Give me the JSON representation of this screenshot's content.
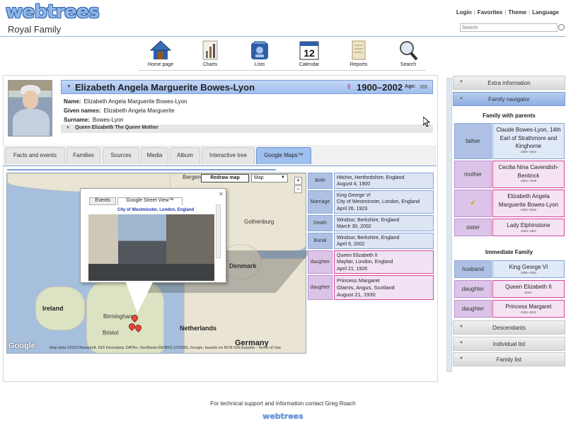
{
  "header": {
    "logo": "webtrees",
    "site_title": "Royal Family",
    "links": [
      "Login",
      "Favorites",
      "Theme",
      "Language"
    ],
    "search_placeholder": "Search"
  },
  "menu": [
    {
      "label": "Home page",
      "icon": "home-icon"
    },
    {
      "label": "Charts",
      "icon": "charts-icon"
    },
    {
      "label": "Lists",
      "icon": "lists-icon"
    },
    {
      "label": "Calendar",
      "icon": "calendar-icon",
      "day": "12"
    },
    {
      "label": "Reports",
      "icon": "reports-icon"
    },
    {
      "label": "Search",
      "icon": "search-icon"
    }
  ],
  "individual": {
    "full_name": "Elizabeth Angela Marguerite Bowes-Lyon",
    "life_years": "1900–2002",
    "age_label": "Age:",
    "age": "101",
    "sex_icon": "female-icon",
    "facts": [
      {
        "label": "Name:",
        "value": "Elizabeth Angela Marguerite Bowes-Lyon"
      },
      {
        "label": "Given names:",
        "value": "Elizabeth Angela Marguerite"
      },
      {
        "label": "Surname:",
        "value": "Bowes-Lyon"
      }
    ],
    "nickname": "Queen Elizabeth The Queen Mother"
  },
  "tabs": [
    "Facts and events",
    "Families",
    "Sources",
    "Media",
    "Album",
    "Interactive tree",
    "Google Maps™"
  ],
  "active_tab": "Google Maps™",
  "map": {
    "redraw_label": "Redraw map",
    "maptype": "Map",
    "zoom_in": "+",
    "zoom_out": "−",
    "popup_tabs": [
      "Events",
      "Google Street View™"
    ],
    "popup_place": "City of Westminster, London, England",
    "labels": {
      "bergen": "Bergen",
      "gothenburg": "Gothenburg",
      "denmark": "Denmark",
      "ireland": "Ireland",
      "birmingham": "Birmingham",
      "bristol": "Bristol",
      "netherlands": "Netherlands",
      "germany": "Germany"
    },
    "google_logo": "Google",
    "credit": "Map data ©2013 Basarsoft, GIS Innovatsia, DATA+, GeoBasis-DE/BKG (©2009), Google, basado en BCN IGN España - Terms of Use"
  },
  "events": [
    {
      "type": "Birth",
      "lines": [
        "Hitchin, Hertfordshire, England",
        "August 4, 1900"
      ],
      "style": "blue"
    },
    {
      "type": "Marriage",
      "lines": [
        "King George VI",
        "City of Westminster, London, England",
        "April 26, 1923"
      ],
      "style": "blue"
    },
    {
      "type": "Death",
      "lines": [
        "Windsor, Berkshire, England",
        "March 30, 2002"
      ],
      "style": "blue"
    },
    {
      "type": "Burial",
      "lines": [
        "Windsor, Berkshire, England",
        "April 9, 2002"
      ],
      "style": "blue"
    },
    {
      "type": "daughter",
      "lines": [
        "Queen Elizabeth II",
        "Mayfair, London, England",
        "April 21, 1926"
      ],
      "style": "pink"
    },
    {
      "type": "daughter",
      "lines": [
        "Princess Margaret",
        "Glamis, Angus, Scotland",
        "August 21, 1930"
      ],
      "style": "pink"
    }
  ],
  "sidebar": {
    "extra_information": "Extra information",
    "family_navigator": "Family navigator",
    "family_with_parents": "Family with parents",
    "parents_family": [
      {
        "role": "father",
        "name": "Claude Bowes-Lyon, 14th Earl of Strathmore and Kinghorne",
        "years": "1855–1944",
        "style": "blue"
      },
      {
        "role": "mother",
        "name": "Cecilia Nina Cavendish-Bentinck",
        "years": "1862–1938",
        "style": "pink"
      },
      {
        "role": "✔",
        "name": "Elizabeth Angela Marguerite Bowes-Lyon",
        "years": "1900–2002",
        "style": "pink"
      },
      {
        "role": "sister",
        "name": "Lady Elphinstone",
        "years": "1883–1961",
        "style": "pink"
      }
    ],
    "immediate_family": "Immediate Family",
    "own_family": [
      {
        "role": "husband",
        "name": "King George VI",
        "years": "1895–1952",
        "style": "blue"
      },
      {
        "role": "daughter",
        "name": "Queen Elizabeth II",
        "years": "1926–",
        "style": "pink"
      },
      {
        "role": "daughter",
        "name": "Princess Margaret",
        "years": "1930–2002",
        "style": "pink"
      }
    ],
    "descendants": "Descendants",
    "individual_list": "Individual list",
    "family_list": "Family list"
  },
  "footer": {
    "text": "For technical support and information contact Greg Roach",
    "logo": "webtrees"
  },
  "colors": {
    "accent_blue": "#9fbff0",
    "female_red": "#c0003b",
    "pink_border": "#d5459a"
  }
}
